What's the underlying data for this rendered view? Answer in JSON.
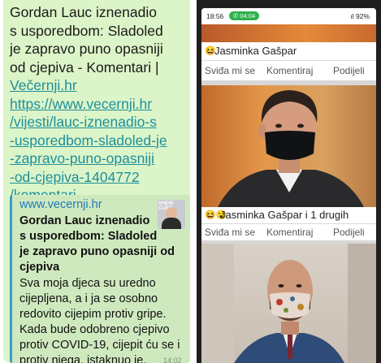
{
  "message": {
    "text_lines": [
      "Gordan Lauc iznenadio",
      "s usporedbom: Sladoled",
      "je zapravo puno opasniji",
      "od cjepiva - Komentari |"
    ],
    "link_lines": [
      "Večernji.hr",
      "https://www.vecernji.hr",
      "/vijesti/lauc-iznenadio-s",
      "-usporedbom-sladoled-je",
      "-zapravo-puno-opasniji",
      "-od-cjepiva-1404772",
      "/komentari"
    ],
    "time": "14:02"
  },
  "preview": {
    "host": "www.vecernji.hr",
    "thumb_text": "VHERI CIJEP",
    "title_lines": [
      "Gordan Lauc iznenadio",
      "s usporedbom: Sladoled",
      "je zapravo puno opasniji od",
      "cjepiva"
    ],
    "desc_lines": [
      "Sva moja djeca su uredno",
      "cijepljena, a i ja se osobno",
      "redovito cijepim protiv gripe.",
      "Kada bude odobreno cjepivo",
      "protiv COVID-19, cijepit ću se i",
      "protiv njega, istaknuo je."
    ]
  },
  "phone": {
    "status": {
      "time": "18:56",
      "call": "04:04",
      "right": "ıl 92%"
    },
    "posts": [
      {
        "reactions_icons": "😆",
        "reactions_text": "Jasminka Gašpar",
        "actions": [
          "Sviđa mi se",
          "Komentiraj",
          "Podijeli"
        ]
      },
      {
        "reactions_icons": "😆😮",
        "reactions_text": "Jasminka Gašpar i 1 drugih",
        "actions": [
          "Sviđa mi se",
          "Komentiraj",
          "Podijeli"
        ]
      }
    ]
  },
  "colors": {
    "bubble": "#dcf5c8",
    "link": "#1e8f9c",
    "preview_bar": "#3a9ad0",
    "call_pill": "#2fb14c"
  }
}
